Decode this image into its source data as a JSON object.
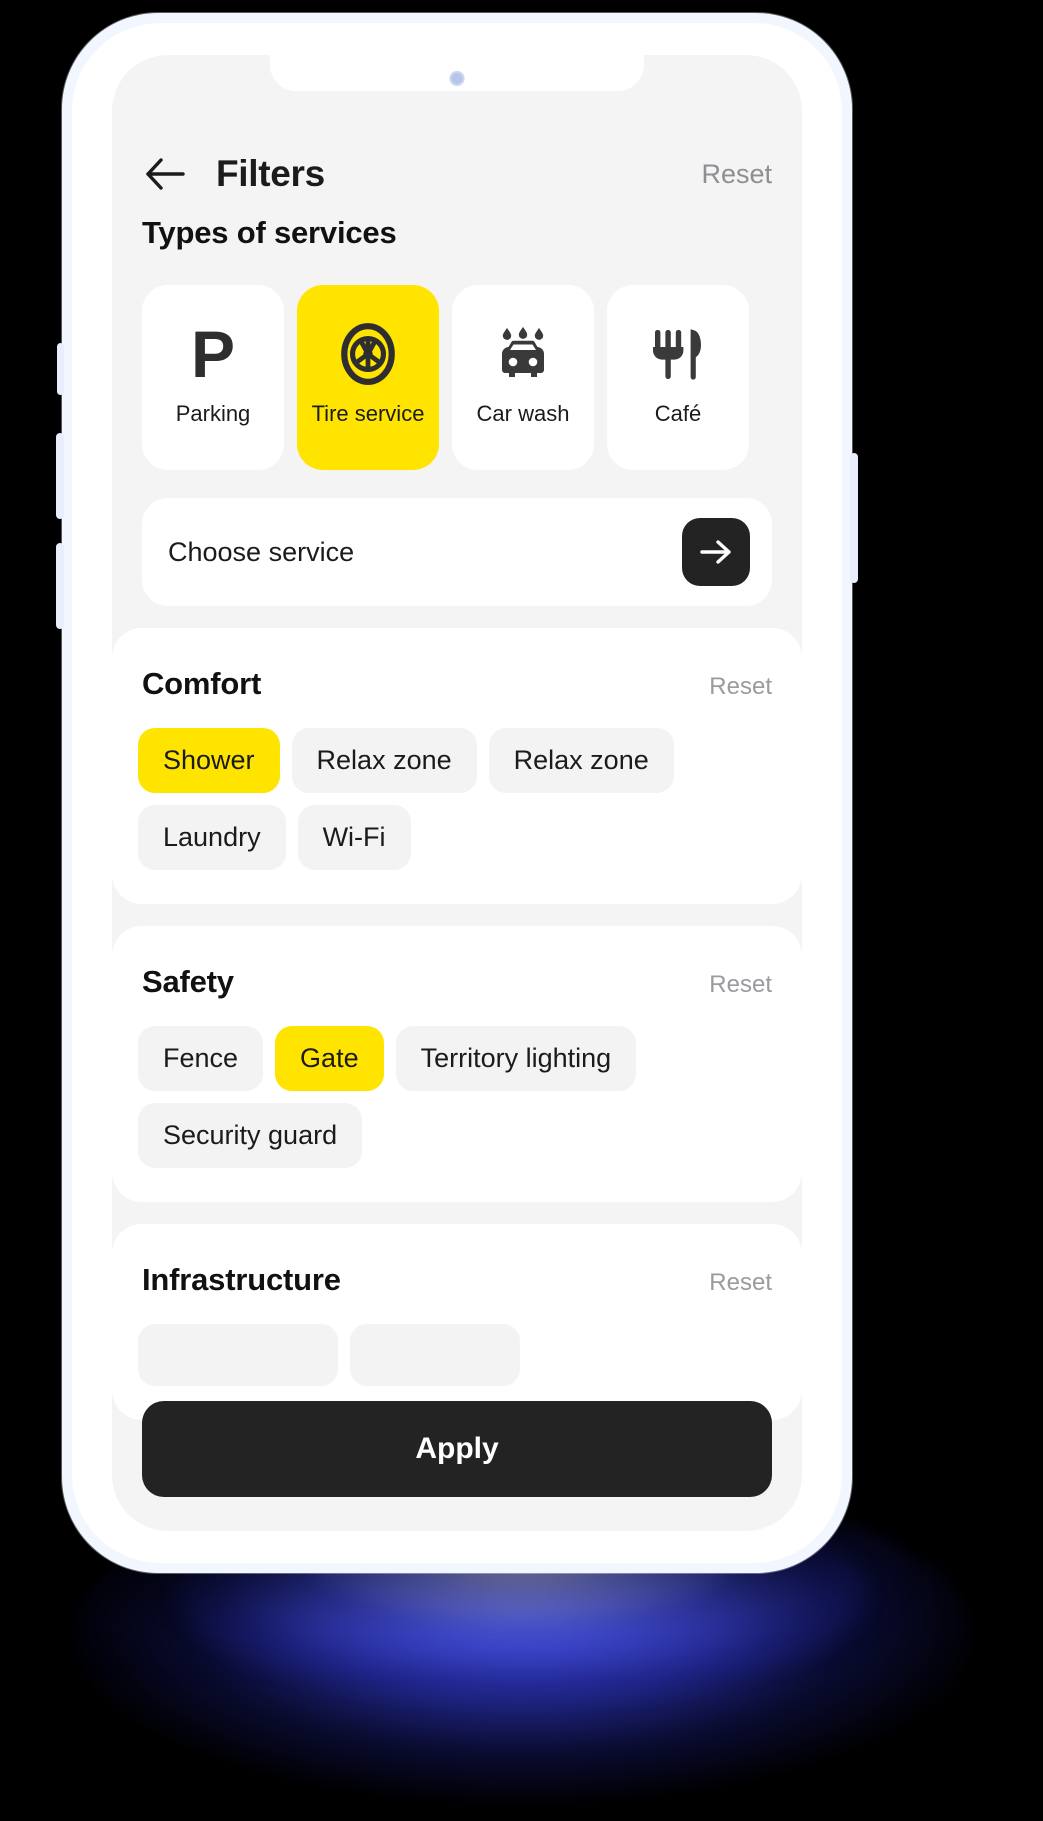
{
  "header": {
    "back_icon": "arrow-left-icon",
    "title": "Filters",
    "reset_label": "Reset"
  },
  "services": {
    "section_title": "Types of services",
    "tiles": [
      {
        "label": "Parking",
        "icon": "parking-p-icon",
        "selected": false
      },
      {
        "label": "Tire service",
        "icon": "tire-wheel-icon",
        "selected": true
      },
      {
        "label": "Car wash",
        "icon": "car-wash-icon",
        "selected": false
      },
      {
        "label": "Café",
        "icon": "fork-knife-icon",
        "selected": false
      }
    ],
    "choose": {
      "label": "Choose service",
      "arrow_icon": "arrow-right-icon"
    }
  },
  "sections": [
    {
      "title": "Comfort",
      "reset_label": "Reset",
      "chips": [
        {
          "label": "Shower",
          "selected": true
        },
        {
          "label": "Relax zone",
          "selected": false
        },
        {
          "label": "Relax zone",
          "selected": false
        },
        {
          "label": "Laundry",
          "selected": false
        },
        {
          "label": "Wi-Fi",
          "selected": false
        }
      ]
    },
    {
      "title": "Safety",
      "reset_label": "Reset",
      "chips": [
        {
          "label": "Fence",
          "selected": false
        },
        {
          "label": "Gate",
          "selected": true
        },
        {
          "label": "Territory lighting",
          "selected": false
        },
        {
          "label": "Security guard",
          "selected": false
        }
      ]
    },
    {
      "title": "Infrastructure",
      "reset_label": "Reset",
      "chips": [
        {
          "label": "",
          "selected": false
        },
        {
          "label": "",
          "selected": false
        }
      ]
    }
  ],
  "footer": {
    "apply_label": "Apply"
  },
  "colors": {
    "accent_yellow": "#ffe400",
    "dark": "#232323",
    "screen_bg": "#f4f4f4",
    "chip_bg": "#f3f3f3",
    "muted_text": "#9a9a9f"
  }
}
